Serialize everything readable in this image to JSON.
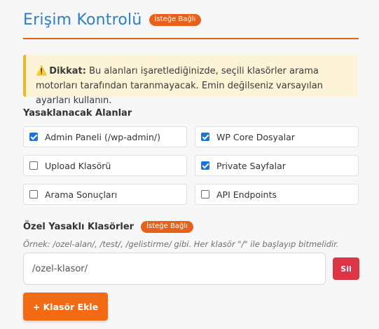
{
  "header": {
    "title": "Erişim Kontrolü",
    "badge": "İsteğe Bağlı"
  },
  "warning": {
    "icon": "warning-icon",
    "strong": "Dikkat:",
    "text": "Bu alanları işaretlediğinizde, seçili klasörler arama motorları tarafından taranmayacak. Emin değilseniz varsayılan ayarları kullanın."
  },
  "blocked_areas": {
    "label": "Yasaklanacak Alanlar",
    "options": [
      {
        "label": "Admin Paneli (/wp-admin/)",
        "checked": true
      },
      {
        "label": "WP Core Dosyalar",
        "checked": true
      },
      {
        "label": "Upload Klasörü",
        "checked": false
      },
      {
        "label": "Private Sayfalar",
        "checked": true
      },
      {
        "label": "Arama Sonuçları",
        "checked": false
      },
      {
        "label": "API Endpoints",
        "checked": false
      }
    ]
  },
  "custom_folders": {
    "label": "Özel Yasaklı Klasörler",
    "badge": "İsteğe Bağlı",
    "example": "Örnek: /ozel-alan/, /test/, /gelistirme/ gibi. Her klasör \"/\" ile başlayıp bitmelidir.",
    "input_value": "/ozel-klasor/",
    "delete_label": "Sil",
    "add_label": "+ Klasör Ekle"
  },
  "colors": {
    "title": "#2b7fc7",
    "accent": "#e8611a",
    "checkbox": "#1a73d9",
    "danger": "#dc3545"
  }
}
